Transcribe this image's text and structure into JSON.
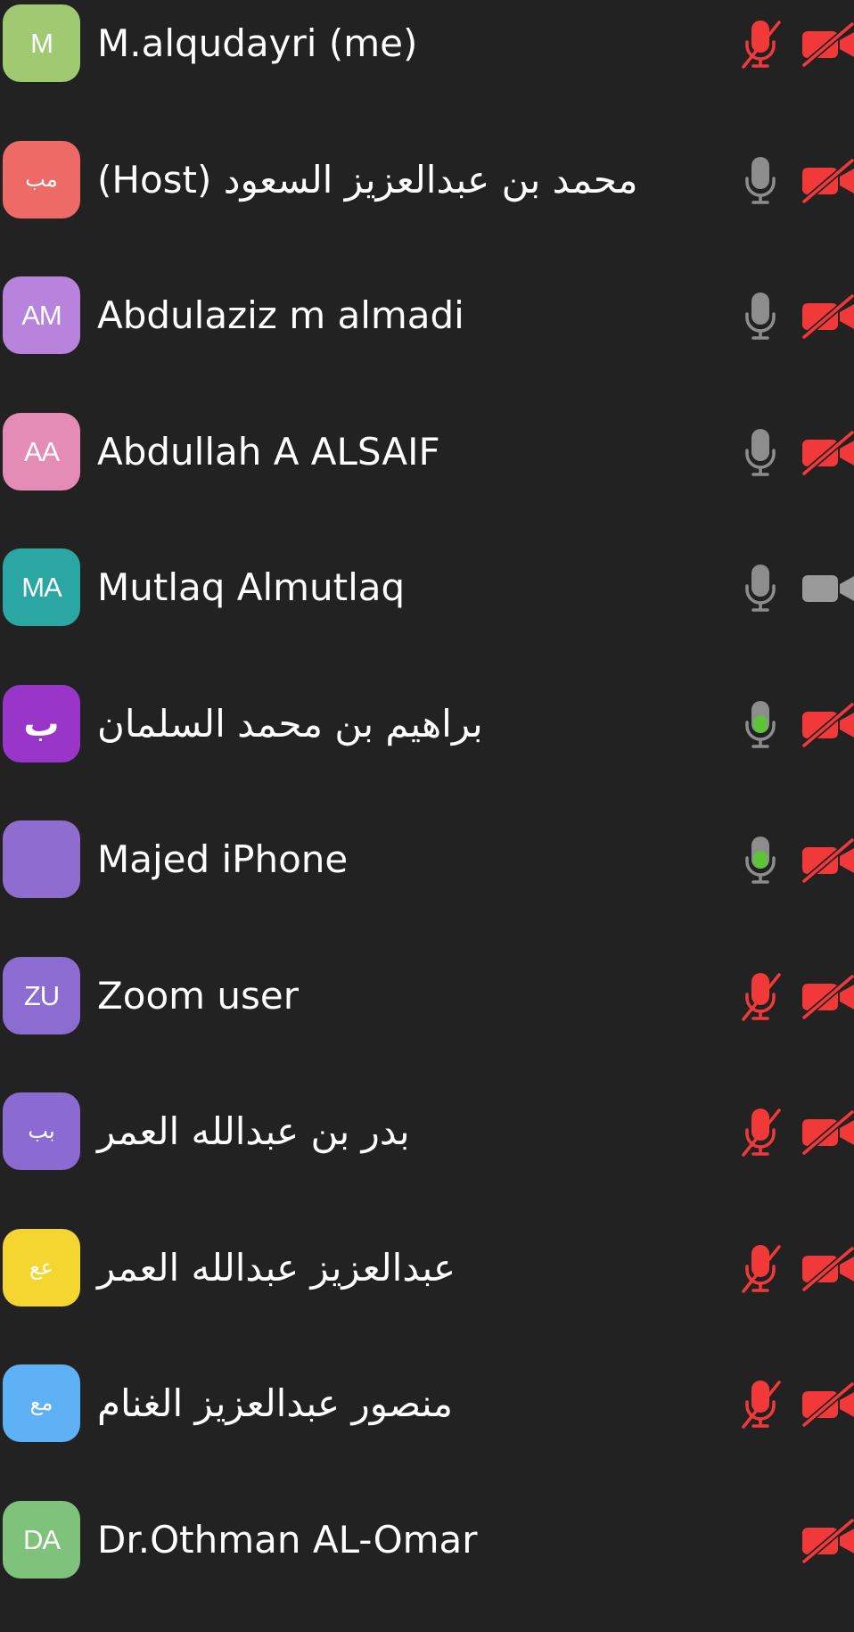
{
  "colors": {
    "background": "#222222",
    "muted_red": "#f2393a",
    "mic_gray": "#8d8d8d",
    "mic_active_green": "#5cc43b",
    "camera_on_gray": "#9a9a9a"
  },
  "participants": [
    {
      "initials": "M",
      "name": "M.alqudayri (me)",
      "avatar_color": "#9fca72",
      "mic": "muted",
      "video": "off"
    },
    {
      "initials": "مب",
      "name": "(Host) محمد بن عبدالعزيز السعود",
      "avatar_color": "#ee6a66",
      "mic": "on",
      "video": "off"
    },
    {
      "initials": "AM",
      "name": "Abdulaziz m almadi",
      "avatar_color": "#b783dc",
      "mic": "on",
      "video": "off"
    },
    {
      "initials": "AA",
      "name": "Abdullah A ALSAIF",
      "avatar_color": "#e48cb5",
      "mic": "on",
      "video": "off"
    },
    {
      "initials": "MA",
      "name": "Mutlaq Almutlaq",
      "avatar_color": "#2aa6a3",
      "mic": "on",
      "video": "on"
    },
    {
      "initials": "ب",
      "name": "براهيم بن محمد السلمان",
      "avatar_color": "#9a35c9",
      "mic": "active",
      "video": "off"
    },
    {
      "initials": "",
      "name": "Majed iPhone",
      "avatar_color": "#8f6dd0",
      "mic": "active",
      "video": "off"
    },
    {
      "initials": "ZU",
      "name": "Zoom user",
      "avatar_color": "#8d6cd1",
      "mic": "muted",
      "video": "off"
    },
    {
      "initials": "بب",
      "name": "بدر بن عبدالله العمر",
      "avatar_color": "#8b6bd1",
      "mic": "muted",
      "video": "off"
    },
    {
      "initials": "عع",
      "name": "عبدالعزيز عبدالله العمر",
      "avatar_color": "#f5d530",
      "mic": "muted",
      "video": "off"
    },
    {
      "initials": "مع",
      "name": "منصور عبدالعزيز الغنام",
      "avatar_color": "#5fb1f5",
      "mic": "muted",
      "video": "off"
    },
    {
      "initials": "DA",
      "name": "Dr.Othman AL-Omar",
      "avatar_color": "#7ec27b",
      "mic": "none",
      "video": "off"
    }
  ]
}
